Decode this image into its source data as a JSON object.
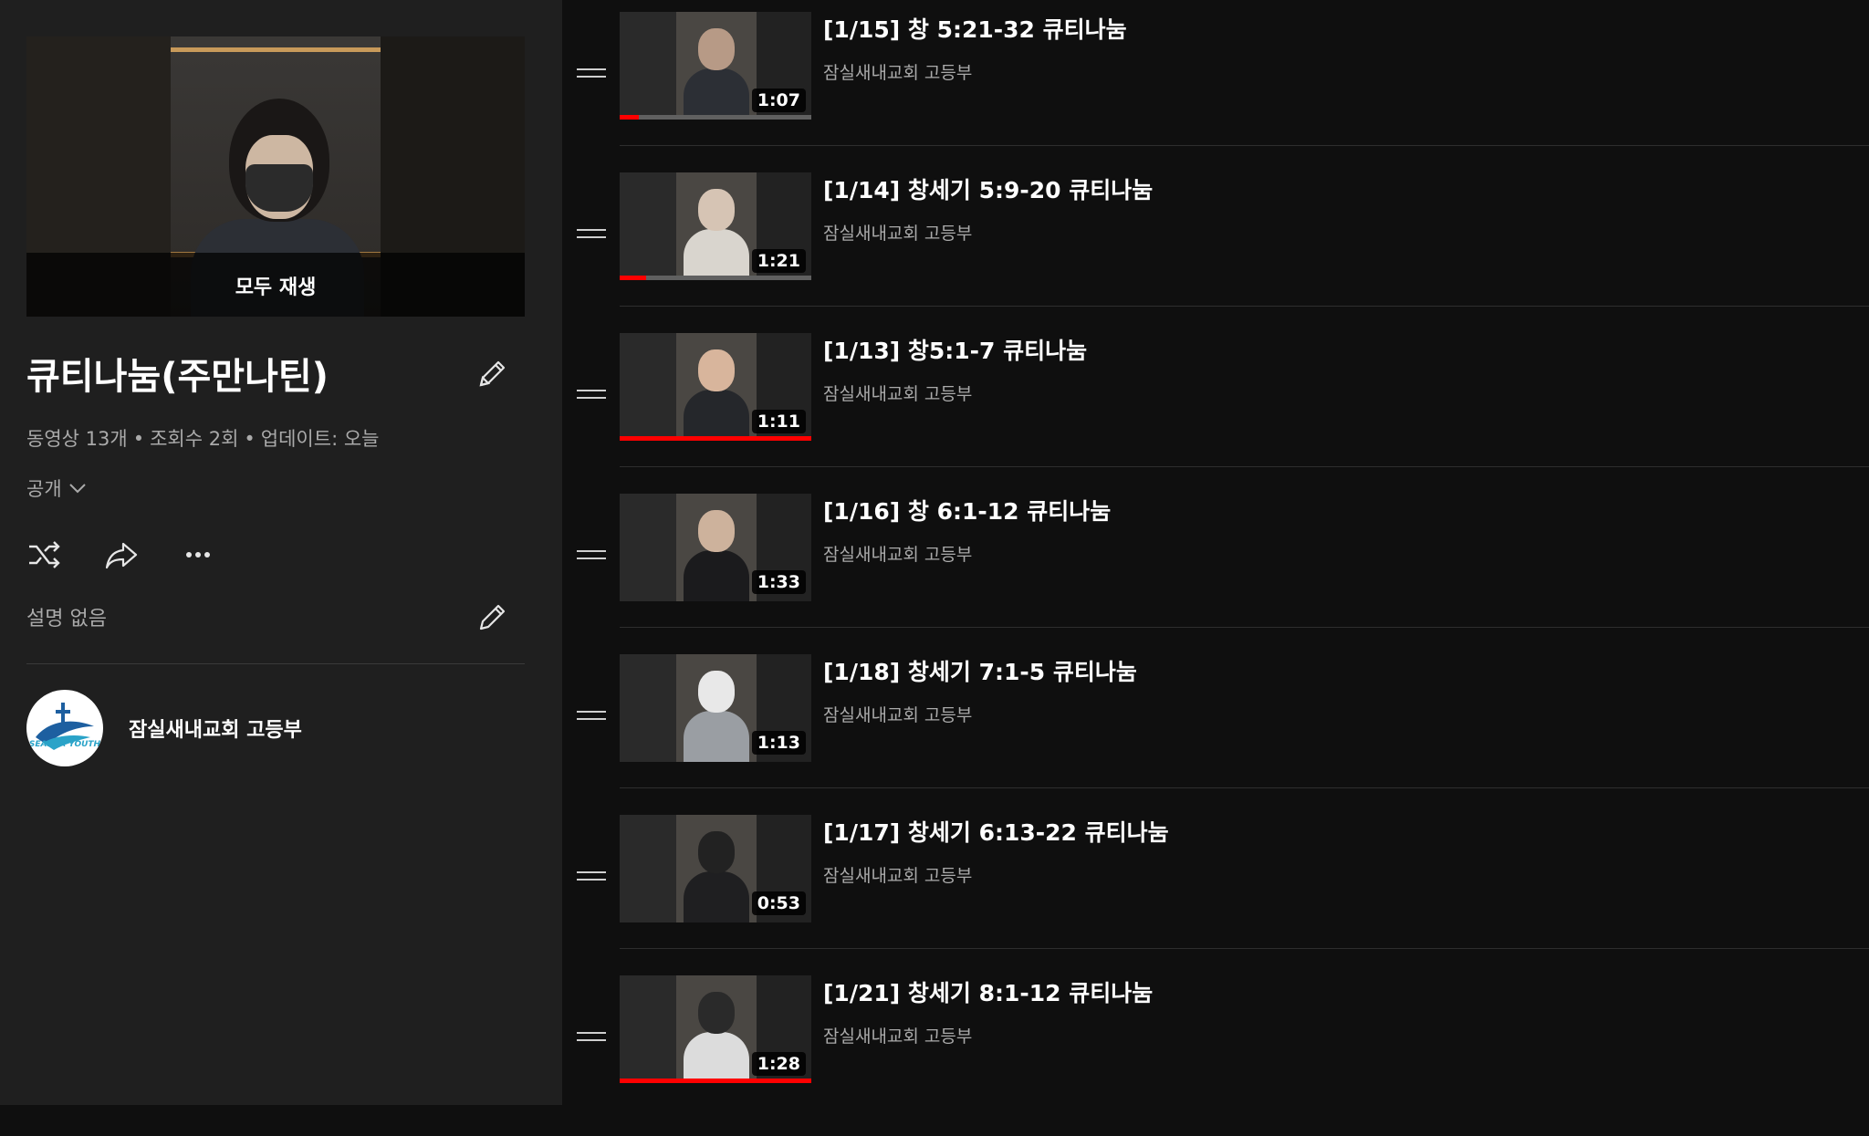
{
  "playlist": {
    "hero_label": "모두 재생",
    "title": "큐티나눔(주만나틴)",
    "video_count": "동영상 13개",
    "views": "조회수 2회",
    "updated": "업데이트: 오늘",
    "privacy": "공개",
    "description": "설명 없음",
    "channel_name": "잠실새내교회 고등부",
    "avatar_text": "SEANEA YOUTH"
  },
  "icons": {
    "edit": "pencil-icon",
    "shuffle": "shuffle-icon",
    "share": "share-icon",
    "more": "more-horiz-icon",
    "privacy_dropdown": "chevron-down-icon",
    "drag": "drag-handle-icon"
  },
  "videos": [
    {
      "title": "[1/15] 창 5:21-32 큐티나눔",
      "channel": "잠실새내교회 고등부",
      "duration": "1:07",
      "progress": 0.1,
      "face": "#b79a86",
      "body": "#2c2f35"
    },
    {
      "title": "[1/14] 창세기 5:9-20 큐티나눔",
      "channel": "잠실새내교회 고등부",
      "duration": "1:21",
      "progress": 0.14,
      "face": "#d6c4b4",
      "body": "#d9d5ce"
    },
    {
      "title": "[1/13] 창5:1-7 큐티나눔",
      "channel": "잠실새내교회 고등부",
      "duration": "1:11",
      "progress": 1.0,
      "face": "#d8b59c",
      "body": "#25272b"
    },
    {
      "title": "[1/16] 창 6:1-12 큐티나눔",
      "channel": "잠실새내교회 고등부",
      "duration": "1:33",
      "progress": 0.0,
      "face": "#cdb29c",
      "body": "#1b1b1d"
    },
    {
      "title": "[1/18] 창세기 7:1-5 큐티나눔",
      "channel": "잠실새내교회 고등부",
      "duration": "1:13",
      "progress": 0.0,
      "face": "#e8e8e8",
      "body": "#9a9ea3"
    },
    {
      "title": "[1/17] 창세기 6:13-22 큐티나눔",
      "channel": "잠실새내교회 고등부",
      "duration": "0:53",
      "progress": 0.0,
      "face": "#222222",
      "body": "#1f1f21"
    },
    {
      "title": "[1/21] 창세기 8:1-12 큐티나눔",
      "channel": "잠실새내교회 고등부",
      "duration": "1:28",
      "progress": 1.0,
      "face": "#2a2a2a",
      "body": "#dcdcdc"
    }
  ]
}
